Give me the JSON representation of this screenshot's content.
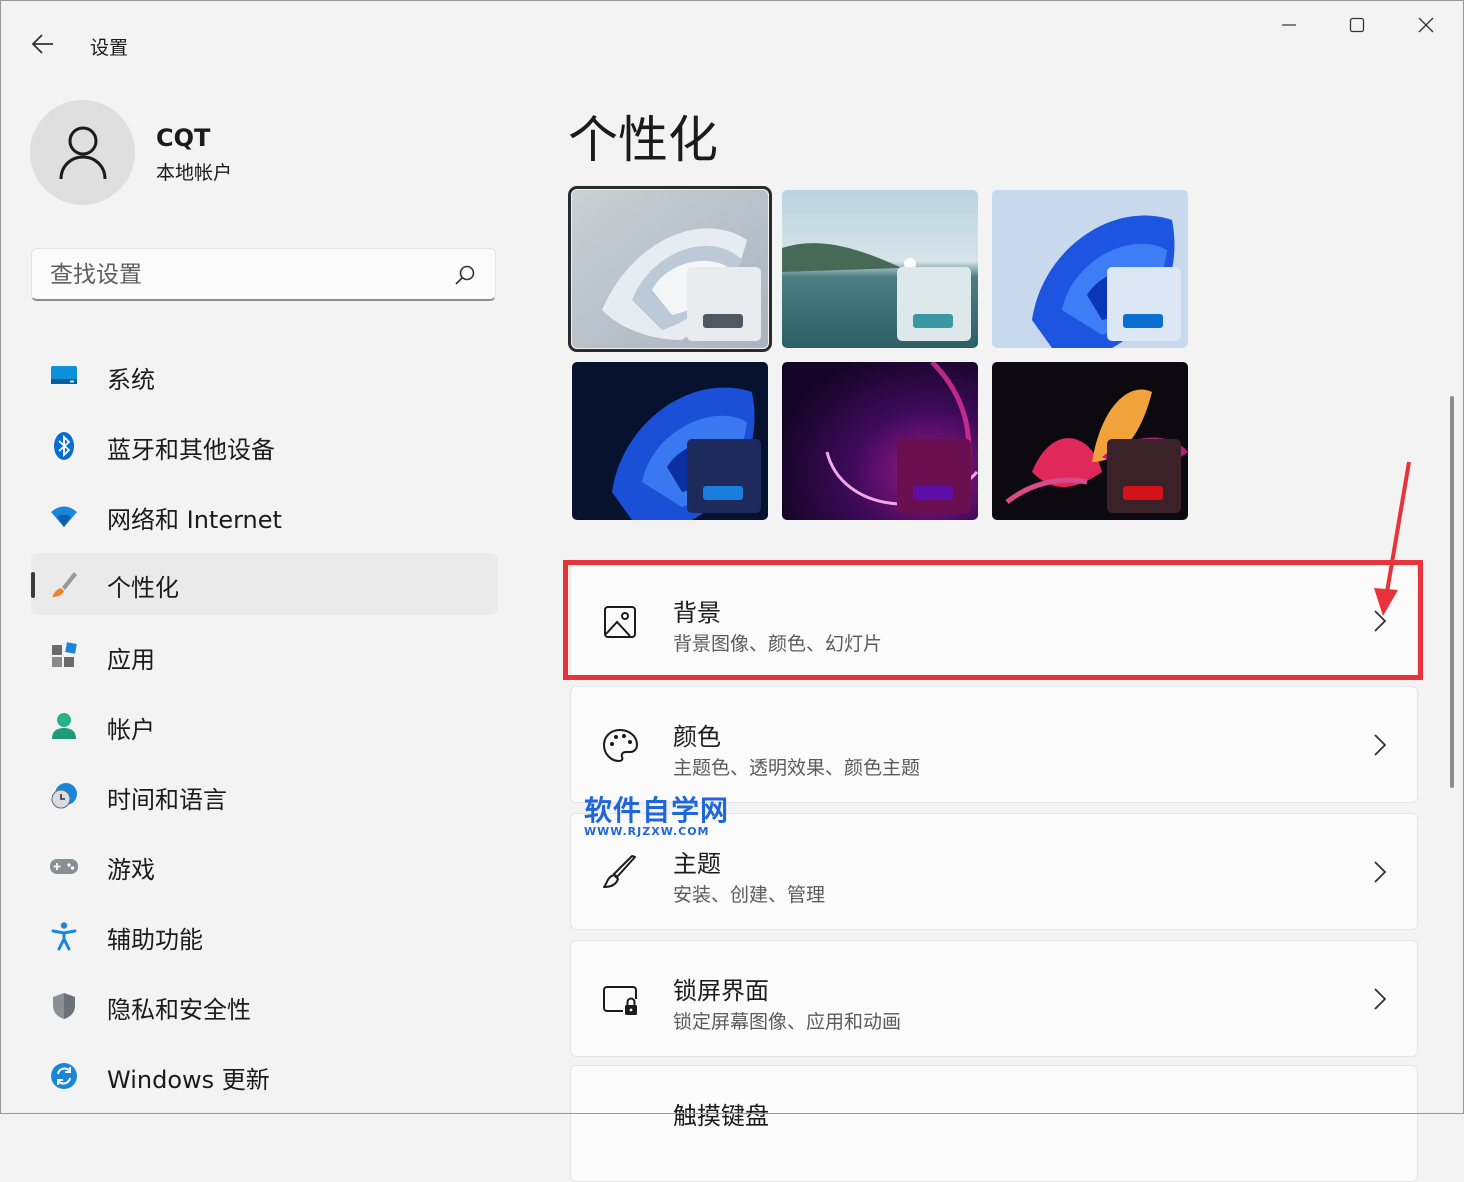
{
  "app": {
    "title": "设置"
  },
  "window_controls": {
    "minimize": "minimize-icon",
    "maximize": "maximize-icon",
    "close": "close-icon"
  },
  "profile": {
    "name": "CQT",
    "account_type": "本地帐户"
  },
  "search": {
    "placeholder": "查找设置"
  },
  "sidebar": {
    "items": [
      {
        "label": "系统",
        "icon": "system-icon"
      },
      {
        "label": "蓝牙和其他设备",
        "icon": "bluetooth-icon"
      },
      {
        "label": "网络和 Internet",
        "icon": "wifi-icon"
      },
      {
        "label": "个性化",
        "icon": "brush-icon",
        "active": true
      },
      {
        "label": "应用",
        "icon": "apps-icon"
      },
      {
        "label": "帐户",
        "icon": "account-icon"
      },
      {
        "label": "时间和语言",
        "icon": "time-language-icon"
      },
      {
        "label": "游戏",
        "icon": "gamepad-icon"
      },
      {
        "label": "辅助功能",
        "icon": "accessibility-icon"
      },
      {
        "label": "隐私和安全性",
        "icon": "shield-icon"
      },
      {
        "label": "Windows 更新",
        "icon": "update-icon"
      }
    ]
  },
  "main": {
    "title": "个性化",
    "themes": [
      {
        "name": "light-bloom",
        "selected": true,
        "preview_bg": "#e8ecef",
        "accent": "#4f5963"
      },
      {
        "name": "glow-lake",
        "preview_bg": "#dde8ea",
        "accent": "#3a97a3"
      },
      {
        "name": "blue-bloom-light",
        "preview_bg": "#dce6f4",
        "accent": "#0a6fd1"
      },
      {
        "name": "blue-bloom-dark",
        "preview_bg": "#1e2a5c",
        "accent": "#1a7fdc"
      },
      {
        "name": "purple-glow",
        "preview_bg": "#6a1050",
        "accent": "#5d0ea8"
      },
      {
        "name": "flower-dark",
        "preview_bg": "#3a2228",
        "accent": "#d3121a"
      }
    ],
    "cards": [
      {
        "title": "背景",
        "subtitle": "背景图像、颜色、幻灯片",
        "icon": "image-icon"
      },
      {
        "title": "颜色",
        "subtitle": "主题色、透明效果、颜色主题",
        "icon": "palette-icon"
      },
      {
        "title": "主题",
        "subtitle": "安装、创建、管理",
        "icon": "brush-icon"
      },
      {
        "title": "锁屏界面",
        "subtitle": "锁定屏幕图像、应用和动画",
        "icon": "lock-screen-icon"
      },
      {
        "title": "触摸键盘",
        "subtitle": "",
        "icon": "keyboard-icon"
      }
    ]
  },
  "watermark": {
    "main": "软件自学网",
    "sub": "WWW.RJZXW.COM"
  },
  "colors": {
    "annotation": "#e8333b",
    "watermark": "#1f66d8",
    "accent": "#0067c0"
  }
}
